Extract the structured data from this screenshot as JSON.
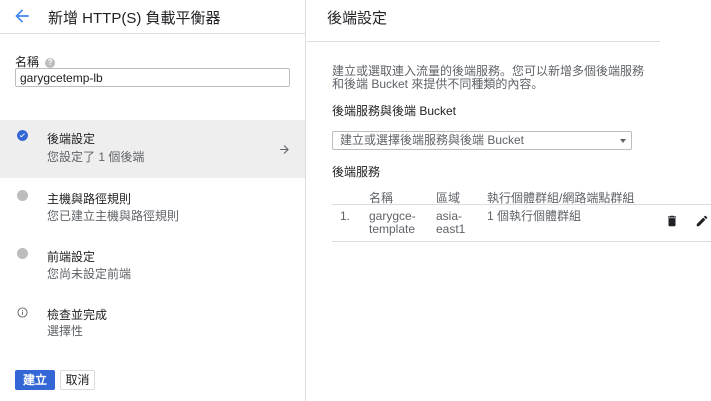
{
  "header": {
    "title": "新增 HTTP(S) 負載平衡器"
  },
  "name_field": {
    "label": "名稱",
    "value": "garygcetemp-lb"
  },
  "steps": [
    {
      "title": "後端設定",
      "subtitle": "您設定了 1 個後端",
      "state": "complete"
    },
    {
      "title": "主機與路徑規則",
      "subtitle": "您已建立主機與路徑規則",
      "state": "pending"
    },
    {
      "title": "前端設定",
      "subtitle": "您尚未設定前端",
      "state": "pending"
    },
    {
      "title": "檢查並完成",
      "subtitle": "選擇性",
      "state": "info"
    }
  ],
  "actions": {
    "create": "建立",
    "cancel": "取消"
  },
  "panel": {
    "title": "後端設定",
    "description": "建立或選取連入流量的後端服務。您可以新增多個後端服務和後端 Bucket 來提供不同種類的內容。",
    "select_section_title": "後端服務與後端 Bucket",
    "select_placeholder": "建立或選擇後端服務與後端 Bucket",
    "services_title": "後端服務",
    "table": {
      "columns": [
        "名稱",
        "區域",
        "執行個體群組/網路端點群組"
      ],
      "rows": [
        {
          "index": "1.",
          "name": "garygce-template",
          "region": "asia-east1",
          "groups": "1 個執行個體群組"
        }
      ]
    }
  },
  "colors": {
    "accent": "#3367d6",
    "active_step_bg": "#eeeeee",
    "pending_dot": "#bdbdbd"
  },
  "icons": [
    "back-arrow-icon",
    "help-icon",
    "check-circle-icon",
    "arrow-right-icon",
    "info-icon",
    "dropdown-caret-icon",
    "delete-icon",
    "edit-icon"
  ]
}
